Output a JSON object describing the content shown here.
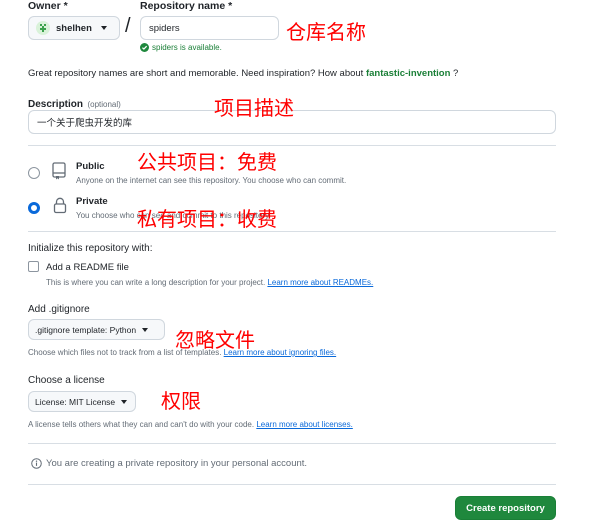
{
  "owner": {
    "label": "Owner *",
    "value": "shelhen"
  },
  "slash": "/",
  "repo_name": {
    "label": "Repository name *",
    "value": "spiders",
    "status": "spiders is available."
  },
  "tip": {
    "text": "Great repository names are short and memorable. Need inspiration? How about ",
    "suggestion": "fantastic-invention",
    "suffix": " ?"
  },
  "description": {
    "label": "Description",
    "optional": "(optional)",
    "value": "一个关于爬虫开发的库"
  },
  "visibility": {
    "public": {
      "title": "Public",
      "desc": "Anyone on the internet can see this repository. You choose who can commit."
    },
    "private": {
      "title": "Private",
      "desc": "You choose who can see and commit to this repository."
    },
    "selected": "private"
  },
  "init": {
    "heading": "Initialize this repository with:",
    "readme_label": "Add a README file",
    "readme_checked": false,
    "readme_help": "This is where you can write a long description for your project. ",
    "readme_link": "Learn more about READMEs."
  },
  "gitignore": {
    "heading": "Add .gitignore",
    "button_label": ".gitignore template: Python",
    "help": "Choose which files not to track from a list of templates. ",
    "link": "Learn more about ignoring files."
  },
  "license": {
    "heading": "Choose a license",
    "button_label": "License: MIT License",
    "help": "A license tells others what they can and can't do with your code. ",
    "link": "Learn more about licenses."
  },
  "notice": {
    "text": "You are creating a private repository in your personal account."
  },
  "submit": {
    "label": "Create repository"
  },
  "annotations": {
    "repo_name": "仓库名称",
    "description": "项目描述",
    "public": "公共项目：免费",
    "private": "私有项目：收费",
    "gitignore": "忽略文件",
    "license": "权限"
  },
  "colors": {
    "accent_green": "#1f883d",
    "radio_blue": "#0969da",
    "annotation_red": "#ff0000",
    "link_blue": "#0969da"
  }
}
